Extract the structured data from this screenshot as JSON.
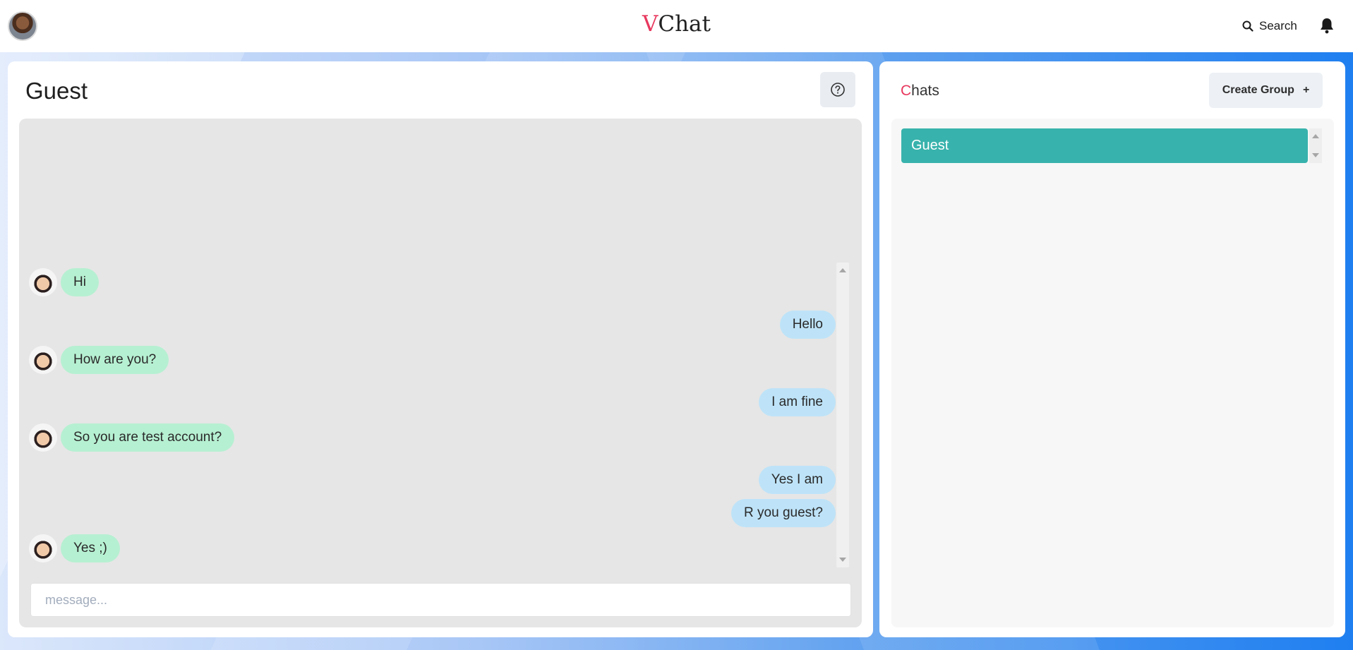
{
  "header": {
    "brand_accent": "V",
    "brand_rest": "Chat",
    "search_label": "Search"
  },
  "chat": {
    "title": "Guest",
    "input_placeholder": "message...",
    "messages": [
      {
        "dir": "in",
        "text": "Hi"
      },
      {
        "dir": "out",
        "text": "Hello"
      },
      {
        "dir": "in",
        "text": "How are you?"
      },
      {
        "dir": "out",
        "text": "I am fine"
      },
      {
        "dir": "in",
        "text": "So you are test account?"
      },
      {
        "dir": "out",
        "text": "Yes I am"
      },
      {
        "dir": "out",
        "text": "R you guest?"
      },
      {
        "dir": "in",
        "text": "Yes ;)"
      }
    ]
  },
  "chats_panel": {
    "title_accent": "C",
    "title_rest": "hats",
    "create_group_label": "Create Group",
    "create_group_icon": "+",
    "items": [
      {
        "name": "Guest",
        "selected": true
      }
    ]
  },
  "colors": {
    "accent": "#e8385e",
    "selected_chat": "#38b2ac",
    "incoming_bubble": "#b6f0d2",
    "outgoing_bubble": "#bee3f8"
  },
  "icons": {
    "search": "search-icon",
    "notifications": "bell-icon",
    "help": "question-circle-icon"
  }
}
